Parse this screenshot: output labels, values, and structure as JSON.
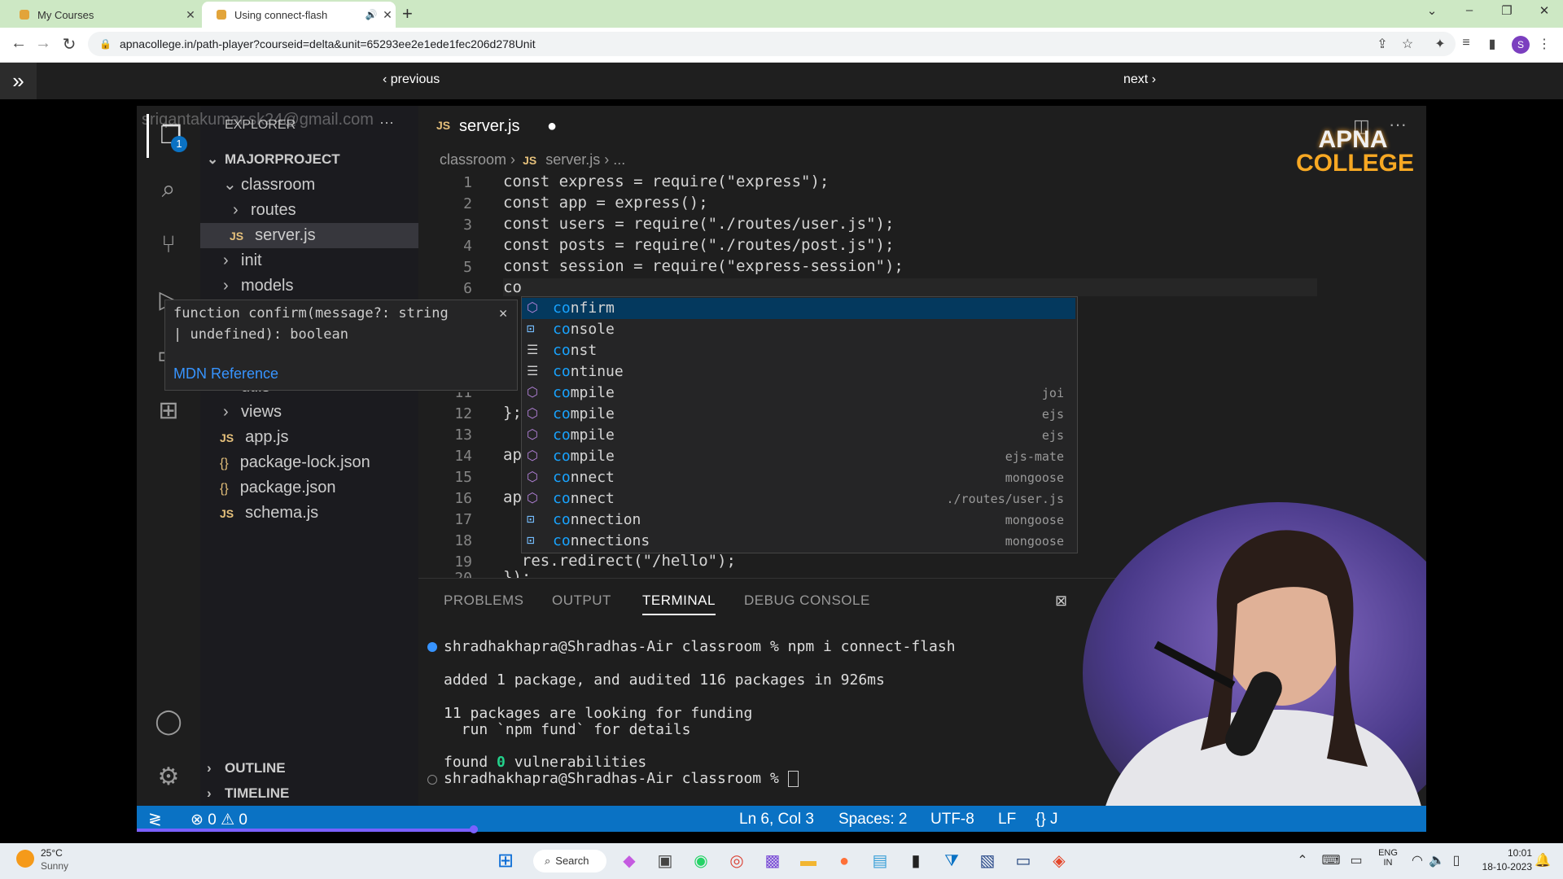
{
  "browser": {
    "tabs": [
      {
        "title": "My Courses"
      },
      {
        "title": "Using connect-flash"
      }
    ],
    "url": "apnacollege.in/path-player?courseid=delta&unit=65293ee2e1ede1fec206d278Unit",
    "profile_initial": "S"
  },
  "course_nav": {
    "previous_label": "‹ previous",
    "next_label": "next ›"
  },
  "video": {
    "watermark_email": "sriqantakumar.sk24@gmail.com",
    "logo_line1": "APNA",
    "logo_line2": "COLLEGE",
    "vscode": {
      "explorer_title": "EXPLORER",
      "explorer_more": "···",
      "project": "MAJORPROJECT",
      "tree": [
        {
          "name": "classroom"
        },
        {
          "name": "routes"
        },
        {
          "name": "server.js"
        },
        {
          "name": "init"
        },
        {
          "name": "models"
        },
        {
          "name": "utils"
        },
        {
          "name": "views"
        },
        {
          "name": "app.js"
        },
        {
          "name": "package-lock.json"
        },
        {
          "name": "package.json"
        },
        {
          "name": "schema.js"
        }
      ],
      "outline": "OUTLINE",
      "timeline": "TIMELINE",
      "explorer_badge": "1",
      "editor_tab": "server.js",
      "breadcrumb": [
        "classroom",
        "server.js",
        "..."
      ],
      "code_lines": [
        {
          "num": "1",
          "text": "const express = require(\"express\");"
        },
        {
          "num": "2",
          "text": "const app = express();"
        },
        {
          "num": "3",
          "text": "const users = require(\"./routes/user.js\");"
        },
        {
          "num": "4",
          "text": "const posts = require(\"./routes/post.js\");"
        },
        {
          "num": "5",
          "text": "const session = require(\"express-session\");"
        },
        {
          "num": "6",
          "text": "co"
        },
        {
          "num": "11",
          "text": ""
        },
        {
          "num": "12",
          "text": "};"
        },
        {
          "num": "13",
          "text": ""
        },
        {
          "num": "14",
          "text": "ap"
        },
        {
          "num": "15",
          "text": ""
        },
        {
          "num": "16",
          "text": "ap"
        },
        {
          "num": "17",
          "text": ""
        },
        {
          "num": "18",
          "text": ""
        },
        {
          "num": "19",
          "text": "  res.redirect(\"/hello\");"
        },
        {
          "num": "20",
          "text": "});"
        }
      ],
      "hover": {
        "signature_line1": "function confirm(message?: string",
        "signature_line2": "| undefined): boolean",
        "link": "MDN Reference",
        "close": "✕"
      },
      "suggestions": [
        {
          "label": "confirm",
          "detail": "",
          "kind": "method"
        },
        {
          "label": "console",
          "detail": "",
          "kind": "variable"
        },
        {
          "label": "const",
          "detail": "",
          "kind": "keyword"
        },
        {
          "label": "continue",
          "detail": "",
          "kind": "keyword"
        },
        {
          "label": "compile",
          "detail": "joi",
          "kind": "method"
        },
        {
          "label": "compile",
          "detail": "ejs",
          "kind": "method"
        },
        {
          "label": "compile",
          "detail": "ejs",
          "kind": "method"
        },
        {
          "label": "compile",
          "detail": "ejs-mate",
          "kind": "method"
        },
        {
          "label": "connect",
          "detail": "mongoose",
          "kind": "method"
        },
        {
          "label": "connect",
          "detail": "./routes/user.js",
          "kind": "method"
        },
        {
          "label": "connection",
          "detail": "mongoose",
          "kind": "variable"
        },
        {
          "label": "connections",
          "detail": "mongoose",
          "kind": "variable"
        }
      ],
      "panel_tabs": [
        "PROBLEMS",
        "OUTPUT",
        "TERMINAL",
        "DEBUG CONSOLE"
      ],
      "terminal": {
        "prompt1": "shradhakhapra@Shradhas-Air classroom % npm i connect-flash",
        "line1": "added 1 package, and audited 116 packages in 926ms",
        "line2": "11 packages are looking for funding",
        "line3": "  run `npm fund` for details",
        "line4_a": "found ",
        "line4_b": "0",
        "line4_c": " vulnerabilities",
        "prompt2": "shradhakhapra@Shradhas-Air classroom % "
      },
      "status": {
        "errors": "0",
        "warnings": "0",
        "position": "Ln 6, Col 3",
        "spaces": "Spaces: 2",
        "encoding": "UTF-8",
        "eol": "LF",
        "lang": "{} J"
      }
    }
  },
  "taskbar": {
    "temp": "25°C",
    "weather": "Sunny",
    "search_label": "Search",
    "lang1": "ENG",
    "lang2": "IN",
    "time": "10:01",
    "date": "18-10-2023"
  }
}
